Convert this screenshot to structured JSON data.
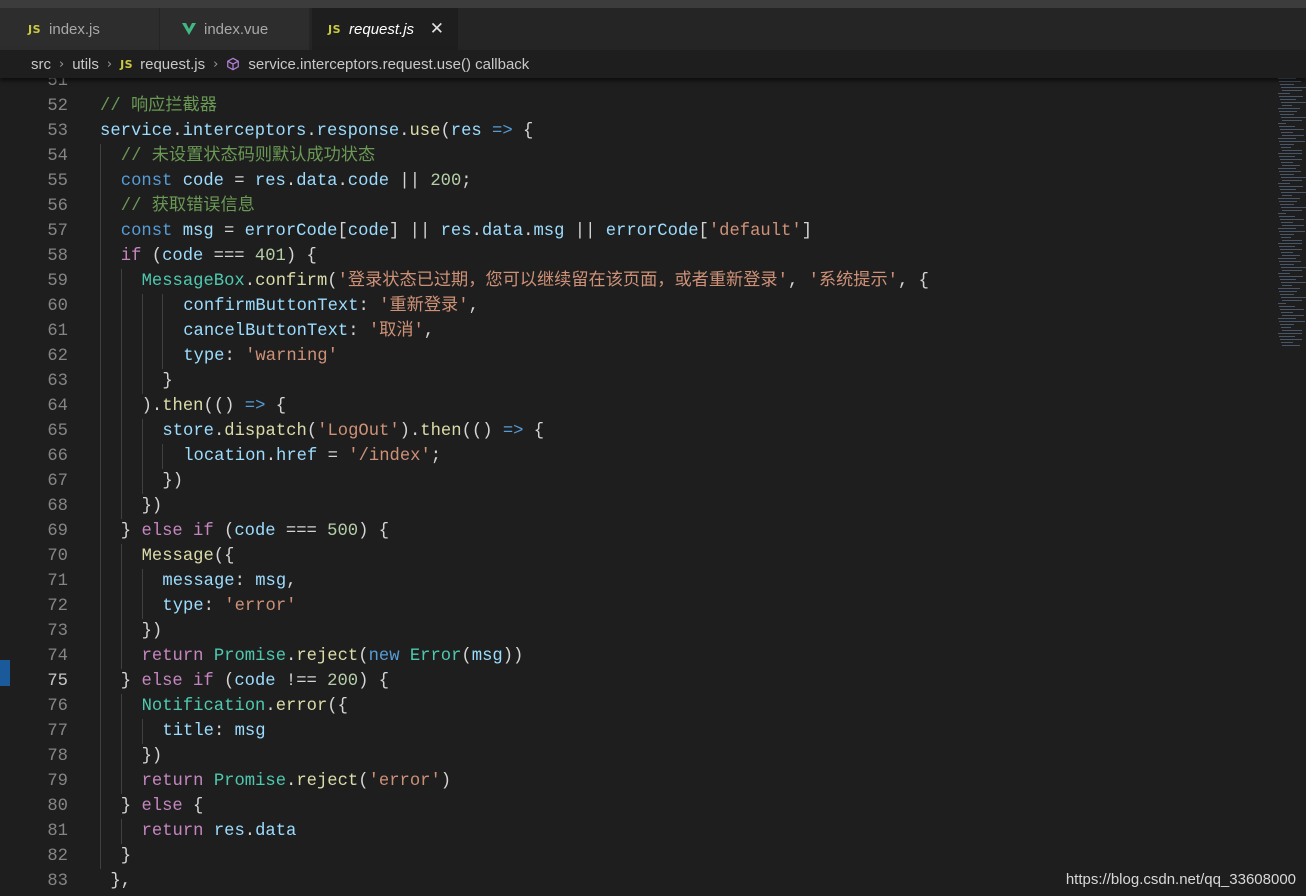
{
  "tabs": [
    {
      "icon": "js-icon",
      "badge": "JS",
      "label": "index.js",
      "active": false
    },
    {
      "icon": "vue-icon",
      "badge": "",
      "label": "index.vue",
      "active": false
    },
    {
      "icon": "js-icon",
      "badge": "JS",
      "label": "request.js",
      "active": true,
      "close": "✕"
    }
  ],
  "breadcrumb": {
    "parts": [
      "src",
      "utils",
      "request.js",
      "service.interceptors.request.use() callback"
    ],
    "file_badge": "JS",
    "separator": "›"
  },
  "editor": {
    "lines": [
      {
        "n": "51",
        "indent": 0,
        "tokens": []
      },
      {
        "n": "52",
        "indent": 0,
        "tokens": [
          [
            "cmt",
            "// 响应拦截器"
          ]
        ]
      },
      {
        "n": "53",
        "indent": 0,
        "tokens": [
          [
            "var",
            "service"
          ],
          [
            "pn",
            "."
          ],
          [
            "var",
            "interceptors"
          ],
          [
            "pn",
            "."
          ],
          [
            "var",
            "response"
          ],
          [
            "pn",
            "."
          ],
          [
            "fn",
            "use"
          ],
          [
            "pn",
            "("
          ],
          [
            "var",
            "res"
          ],
          [
            "pn",
            " "
          ],
          [
            "kw",
            "=>"
          ],
          [
            "pn",
            " {"
          ]
        ]
      },
      {
        "n": "54",
        "indent": 1,
        "tokens": [
          [
            "cmt",
            "// 未设置状态码则默认成功状态"
          ]
        ]
      },
      {
        "n": "55",
        "indent": 1,
        "tokens": [
          [
            "kw",
            "const"
          ],
          [
            "pn",
            " "
          ],
          [
            "var",
            "code"
          ],
          [
            "pn",
            " = "
          ],
          [
            "var",
            "res"
          ],
          [
            "pn",
            "."
          ],
          [
            "var",
            "data"
          ],
          [
            "pn",
            "."
          ],
          [
            "var",
            "code"
          ],
          [
            "pn",
            " || "
          ],
          [
            "num",
            "200"
          ],
          [
            "pn",
            ";"
          ]
        ]
      },
      {
        "n": "56",
        "indent": 1,
        "tokens": [
          [
            "cmt",
            "// 获取错误信息"
          ]
        ]
      },
      {
        "n": "57",
        "indent": 1,
        "tokens": [
          [
            "kw",
            "const"
          ],
          [
            "pn",
            " "
          ],
          [
            "var",
            "msg"
          ],
          [
            "pn",
            " = "
          ],
          [
            "var",
            "errorCode"
          ],
          [
            "pn",
            "["
          ],
          [
            "var",
            "code"
          ],
          [
            "pn",
            "] || "
          ],
          [
            "var",
            "res"
          ],
          [
            "pn",
            "."
          ],
          [
            "var",
            "data"
          ],
          [
            "pn",
            "."
          ],
          [
            "var",
            "msg"
          ],
          [
            "pn",
            " || "
          ],
          [
            "var",
            "errorCode"
          ],
          [
            "pn",
            "["
          ],
          [
            "str",
            "'default'"
          ],
          [
            "pn",
            "]"
          ]
        ]
      },
      {
        "n": "58",
        "indent": 1,
        "tokens": [
          [
            "ctl",
            "if"
          ],
          [
            "pn",
            " ("
          ],
          [
            "var",
            "code"
          ],
          [
            "pn",
            " === "
          ],
          [
            "num",
            "401"
          ],
          [
            "pn",
            ") {"
          ]
        ]
      },
      {
        "n": "59",
        "indent": 2,
        "tokens": [
          [
            "cls",
            "MessageBox"
          ],
          [
            "pn",
            "."
          ],
          [
            "fn",
            "confirm"
          ],
          [
            "pn",
            "("
          ],
          [
            "str",
            "'登录状态已过期，您可以继续留在该页面，或者重新登录'"
          ],
          [
            "pn",
            ", "
          ],
          [
            "str",
            "'系统提示'"
          ],
          [
            "pn",
            ", {"
          ]
        ]
      },
      {
        "n": "60",
        "indent": 4,
        "tokens": [
          [
            "var",
            "confirmButtonText"
          ],
          [
            "pn",
            ": "
          ],
          [
            "str",
            "'重新登录'"
          ],
          [
            "pn",
            ","
          ]
        ]
      },
      {
        "n": "61",
        "indent": 4,
        "tokens": [
          [
            "var",
            "cancelButtonText"
          ],
          [
            "pn",
            ": "
          ],
          [
            "str",
            "'取消'"
          ],
          [
            "pn",
            ","
          ]
        ]
      },
      {
        "n": "62",
        "indent": 4,
        "tokens": [
          [
            "var",
            "type"
          ],
          [
            "pn",
            ": "
          ],
          [
            "str",
            "'warning'"
          ]
        ]
      },
      {
        "n": "63",
        "indent": 3,
        "tokens": [
          [
            "pn",
            "}"
          ]
        ]
      },
      {
        "n": "64",
        "indent": 2,
        "tokens": [
          [
            "pn",
            ")."
          ],
          [
            "fn",
            "then"
          ],
          [
            "pn",
            "(() "
          ],
          [
            "kw",
            "=>"
          ],
          [
            "pn",
            " {"
          ]
        ]
      },
      {
        "n": "65",
        "indent": 3,
        "tokens": [
          [
            "var",
            "store"
          ],
          [
            "pn",
            "."
          ],
          [
            "fn",
            "dispatch"
          ],
          [
            "pn",
            "("
          ],
          [
            "str",
            "'LogOut'"
          ],
          [
            "pn",
            ")."
          ],
          [
            "fn",
            "then"
          ],
          [
            "pn",
            "(() "
          ],
          [
            "kw",
            "=>"
          ],
          [
            "pn",
            " {"
          ]
        ]
      },
      {
        "n": "66",
        "indent": 4,
        "tokens": [
          [
            "var",
            "location"
          ],
          [
            "pn",
            "."
          ],
          [
            "var",
            "href"
          ],
          [
            "pn",
            " = "
          ],
          [
            "str",
            "'/index'"
          ],
          [
            "pn",
            ";"
          ]
        ]
      },
      {
        "n": "67",
        "indent": 3,
        "tokens": [
          [
            "pn",
            "})"
          ]
        ]
      },
      {
        "n": "68",
        "indent": 2,
        "tokens": [
          [
            "pn",
            "})"
          ]
        ]
      },
      {
        "n": "69",
        "indent": 1,
        "tokens": [
          [
            "pn",
            "} "
          ],
          [
            "ctl",
            "else"
          ],
          [
            "pn",
            " "
          ],
          [
            "ctl",
            "if"
          ],
          [
            "pn",
            " ("
          ],
          [
            "var",
            "code"
          ],
          [
            "pn",
            " === "
          ],
          [
            "num",
            "500"
          ],
          [
            "pn",
            ") {"
          ]
        ]
      },
      {
        "n": "70",
        "indent": 2,
        "tokens": [
          [
            "fn",
            "Message"
          ],
          [
            "pn",
            "({"
          ]
        ]
      },
      {
        "n": "71",
        "indent": 3,
        "tokens": [
          [
            "var",
            "message"
          ],
          [
            "pn",
            ": "
          ],
          [
            "var",
            "msg"
          ],
          [
            "pn",
            ","
          ]
        ]
      },
      {
        "n": "72",
        "indent": 3,
        "tokens": [
          [
            "var",
            "type"
          ],
          [
            "pn",
            ": "
          ],
          [
            "str",
            "'error'"
          ]
        ]
      },
      {
        "n": "73",
        "indent": 2,
        "tokens": [
          [
            "pn",
            "})"
          ]
        ]
      },
      {
        "n": "74",
        "indent": 2,
        "tokens": [
          [
            "ctl",
            "return"
          ],
          [
            "pn",
            " "
          ],
          [
            "cls",
            "Promise"
          ],
          [
            "pn",
            "."
          ],
          [
            "fn",
            "reject"
          ],
          [
            "pn",
            "("
          ],
          [
            "kw",
            "new"
          ],
          [
            "pn",
            " "
          ],
          [
            "cls",
            "Error"
          ],
          [
            "pn",
            "("
          ],
          [
            "var",
            "msg"
          ],
          [
            "pn",
            "))"
          ]
        ]
      },
      {
        "n": "75",
        "indent": 1,
        "tokens": [
          [
            "pn",
            "} "
          ],
          [
            "ctl",
            "else"
          ],
          [
            "pn",
            " "
          ],
          [
            "ctl",
            "if"
          ],
          [
            "pn",
            " ("
          ],
          [
            "var",
            "code"
          ],
          [
            "pn",
            " !== "
          ],
          [
            "num",
            "200"
          ],
          [
            "pn",
            ") {"
          ]
        ]
      },
      {
        "n": "76",
        "indent": 2,
        "tokens": [
          [
            "cls",
            "Notification"
          ],
          [
            "pn",
            "."
          ],
          [
            "fn",
            "error"
          ],
          [
            "pn",
            "({"
          ]
        ]
      },
      {
        "n": "77",
        "indent": 3,
        "tokens": [
          [
            "var",
            "title"
          ],
          [
            "pn",
            ": "
          ],
          [
            "var",
            "msg"
          ]
        ]
      },
      {
        "n": "78",
        "indent": 2,
        "tokens": [
          [
            "pn",
            "})"
          ]
        ]
      },
      {
        "n": "79",
        "indent": 2,
        "tokens": [
          [
            "ctl",
            "return"
          ],
          [
            "pn",
            " "
          ],
          [
            "cls",
            "Promise"
          ],
          [
            "pn",
            "."
          ],
          [
            "fn",
            "reject"
          ],
          [
            "pn",
            "("
          ],
          [
            "str",
            "'error'"
          ],
          [
            "pn",
            ")"
          ]
        ]
      },
      {
        "n": "80",
        "indent": 1,
        "tokens": [
          [
            "pn",
            "} "
          ],
          [
            "ctl",
            "else"
          ],
          [
            "pn",
            " {"
          ]
        ]
      },
      {
        "n": "81",
        "indent": 2,
        "tokens": [
          [
            "ctl",
            "return"
          ],
          [
            "pn",
            " "
          ],
          [
            "var",
            "res"
          ],
          [
            "pn",
            "."
          ],
          [
            "var",
            "data"
          ]
        ]
      },
      {
        "n": "82",
        "indent": 1,
        "tokens": [
          [
            "pn",
            "}"
          ]
        ]
      },
      {
        "n": "83",
        "indent": 0.5,
        "tokens": [
          [
            "pn",
            "},"
          ]
        ]
      }
    ]
  },
  "colors": {
    "background": "#1e1e1e",
    "keyword": "#569cd6",
    "control": "#c586c0",
    "variable": "#9cdcfe",
    "class": "#4ec9b0",
    "function": "#dcdcaa",
    "string": "#ce9178",
    "number": "#b5cea8",
    "comment": "#6a9955"
  },
  "watermark": "https://blog.csdn.net/qq_33608000"
}
